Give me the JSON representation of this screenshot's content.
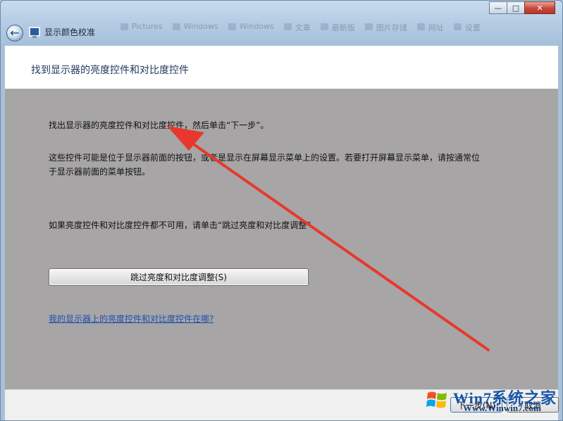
{
  "window": {
    "title": "显示颜色校准",
    "minimize_glyph": "—",
    "maximize_glyph": "□",
    "close_glyph": "✕",
    "bg_ghost_items": [
      "Pictures",
      "Windows",
      "Windows",
      "文章",
      "最新版",
      "图片存储",
      "网址",
      "设置"
    ]
  },
  "header": {
    "title": "找到显示器的亮度控件和对比度控件"
  },
  "content": {
    "instruction": "找出显示器的亮度控件和对比度控件，然后单击“下一步”。",
    "description": "这些控件可能是位于显示器前面的按钮，或者是显示在屏幕显示菜单上的设置。若要打开屏幕显示菜单，请按通常位于显示器前面的菜单按钮。",
    "fallback": "如果亮度控件和对比度控件都不可用，请单击“跳过亮度和对比度调整”。",
    "skip_button": "跳过亮度和对比度调整(S)",
    "help_link": "我的显示器上的亮度控件和对比度控件在哪?"
  },
  "footer": {
    "next_button": "下一步(N)",
    "cancel_button": "取消"
  },
  "watermark": {
    "brand": "Win7系统之家",
    "url": "Www.Winwin7.com"
  },
  "annotation": {
    "arrow_color": "#e8382e",
    "icon": "red-arrow"
  },
  "colors": {
    "content_bg": "#a7a5a6",
    "link": "#1f4fb0",
    "header_text": "#1e395b"
  }
}
